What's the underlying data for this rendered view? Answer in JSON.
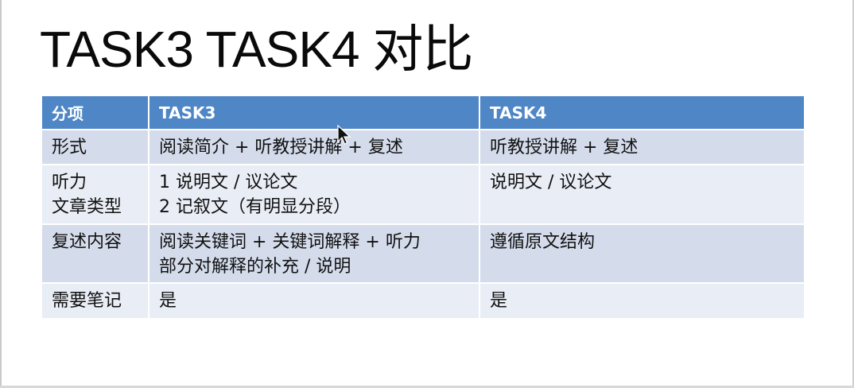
{
  "slide": {
    "title": "TASK3 TASK4 对比"
  },
  "table": {
    "headers": [
      "分项",
      "TASK3",
      "TASK4"
    ],
    "rows": [
      {
        "item": [
          "形式"
        ],
        "task3": [
          "阅读简介 + 听教授讲解 + 复述"
        ],
        "task4": [
          "听教授讲解 + 复述"
        ]
      },
      {
        "item": [
          "听力",
          "文章类型"
        ],
        "task3": [
          "1 说明文 / 议论文",
          "2 记叙文（有明显分段）"
        ],
        "task4": [
          "说明文 / 议论文"
        ]
      },
      {
        "item": [
          "复述内容"
        ],
        "task3": [
          "阅读关键词 + 关键词解释 + 听力",
          "部分对解释的补充 / 说明"
        ],
        "task4": [
          "遵循原文结构"
        ]
      },
      {
        "item": [
          "需要笔记"
        ],
        "task3": [
          "是"
        ],
        "task4": [
          "是"
        ]
      }
    ]
  },
  "colors": {
    "header_bg": "#4f86c6",
    "row_dark": "#d4dcec",
    "row_light": "#e9edf5"
  },
  "icons": {
    "cursor": "mouse-pointer-icon"
  }
}
